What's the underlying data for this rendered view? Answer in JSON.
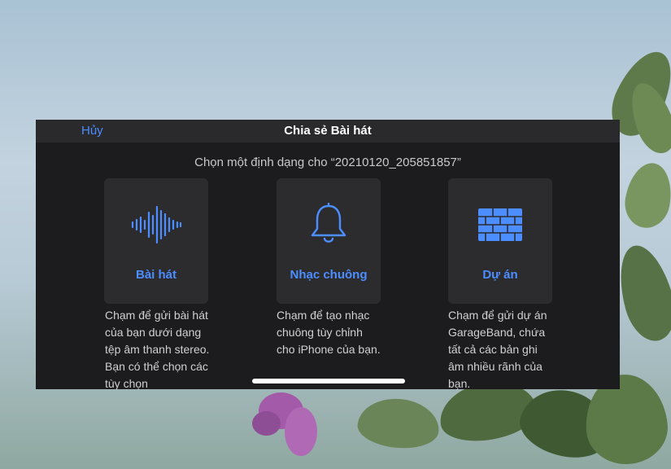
{
  "header": {
    "cancel_label": "Hủy",
    "title": "Chia sẻ Bài hát"
  },
  "subtitle": "Chọn một định dạng cho “20210120_205851857”",
  "options": [
    {
      "label": "Bài hát",
      "icon": "waveform-icon",
      "description": "Chạm để gửi bài hát của bạn dưới dạng tệp âm thanh stereo. Bạn có thể chọn các tùy chọn"
    },
    {
      "label": "Nhạc chuông",
      "icon": "bell-icon",
      "description": "Chạm để tạo nhạc chuông tùy chỉnh cho iPhone của bạn."
    },
    {
      "label": "Dự án",
      "icon": "brick-wall-icon",
      "description": "Chạm để gửi dự án GarageBand, chứa tất cả các bản ghi âm nhiều rãnh của bạn."
    }
  ],
  "colors": {
    "accent": "#4c8dff",
    "sheet_background": "#1c1c1e",
    "card_background": "#2c2c2e"
  }
}
